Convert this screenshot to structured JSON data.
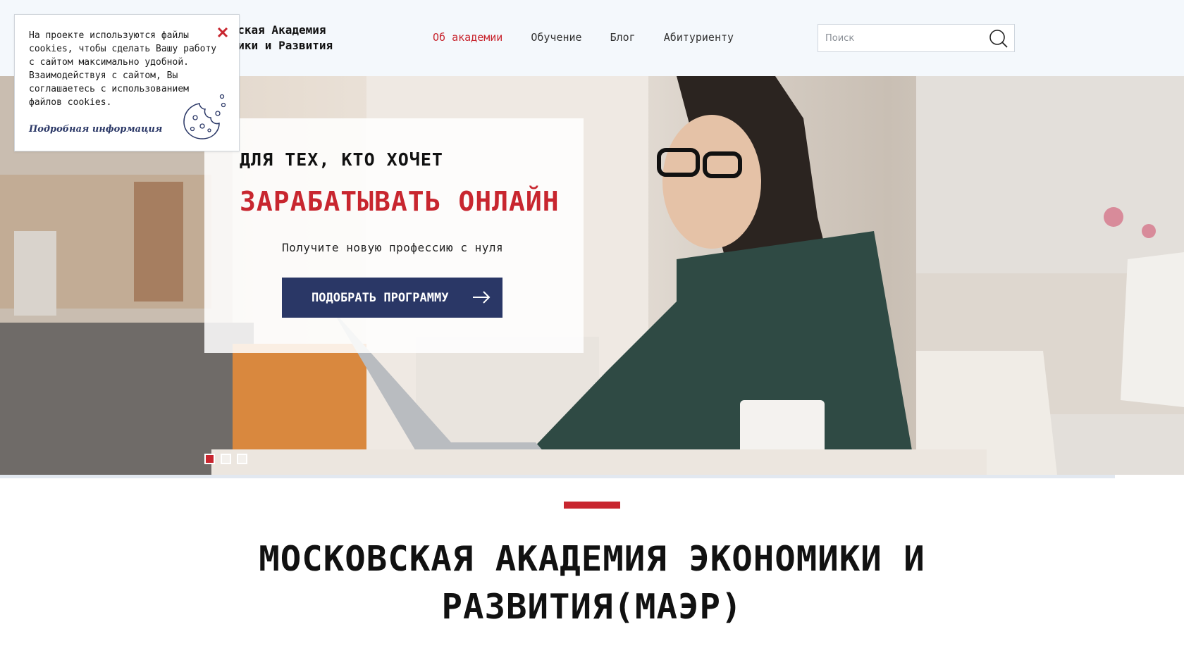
{
  "header": {
    "logo_line1": "овская Академия",
    "logo_line2": "омики и Развития",
    "nav": [
      {
        "label": "Об академии",
        "active": true
      },
      {
        "label": "Обучение",
        "active": false
      },
      {
        "label": "Блог",
        "active": false
      },
      {
        "label": "Абитуриенту",
        "active": false
      }
    ],
    "search_placeholder": "Поиск",
    "search_icon": "search-icon"
  },
  "hero": {
    "subtitle": "ДЛЯ ТЕХ, КТО ХОЧЕТ",
    "title": "ЗАРАБАТЫВАТЬ ОНЛАЙН",
    "text": "Получите новую профессию с нуля",
    "button_label": "ПОДОБРАТЬ ПРОГРАММУ",
    "button_icon": "arrow-right-icon",
    "slides": [
      {
        "active": true
      },
      {
        "active": false
      },
      {
        "active": false
      }
    ]
  },
  "section": {
    "title_line1": "МОСКОВСКАЯ АКАДЕМИЯ ЭКОНОМИКИ И",
    "title_line2": "РАЗВИТИЯ(МАЭР)"
  },
  "cookie": {
    "text": "На проекте используются файлы cookies, чтобы сделать Вашу работу с сайтом максимально удобной. Взаимодействуя с сайтом, Вы соглашаетесь с использованием файлов cookies.",
    "link": "Подробная информация",
    "close_icon": "close-icon",
    "illustration": "cookie-icon"
  },
  "colors": {
    "accent": "#c8262f",
    "brand_navy": "#2a3766",
    "header_bg": "#f4f8fc"
  }
}
